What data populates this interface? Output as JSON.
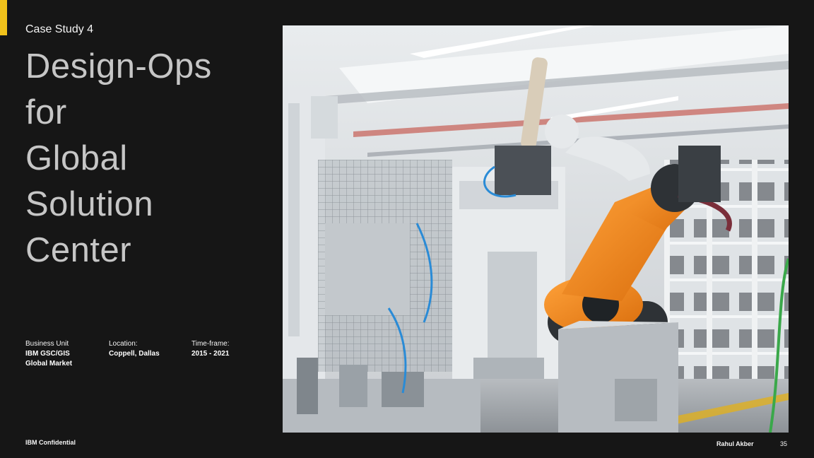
{
  "slide": {
    "eyebrow": "Case Study 4",
    "title_lines": [
      "Design-Ops",
      "for",
      "Global",
      "Solution",
      "Center"
    ],
    "meta": {
      "business_unit": {
        "label": "Business Unit",
        "value_lines": [
          "IBM GSC/GIS",
          "Global Market"
        ]
      },
      "location": {
        "label": "Location:",
        "value": "Coppell, Dallas"
      },
      "timeframe": {
        "label": "Time-frame:",
        "value": "2015 - 2021"
      }
    },
    "footer": {
      "confidential": "IBM Confidential",
      "author": "Rahul Akber",
      "page_number": "35"
    }
  },
  "colors": {
    "background": "#161616",
    "accent": "#f1c21b",
    "robot_orange": "#f08a1c"
  },
  "image": {
    "subject": "industrial-robot-arm-photo"
  }
}
